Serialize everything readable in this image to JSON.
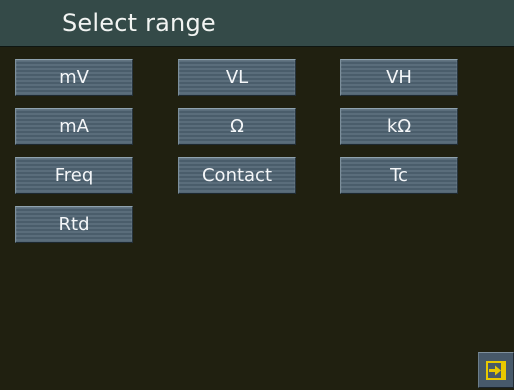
{
  "header": {
    "title": "Select range"
  },
  "ranges": [
    {
      "label": "mV"
    },
    {
      "label": "VL"
    },
    {
      "label": "VH"
    },
    {
      "label": "mA"
    },
    {
      "label": "Ω"
    },
    {
      "label": "kΩ"
    },
    {
      "label": "Freq"
    },
    {
      "label": "Contact"
    },
    {
      "label": "Tc"
    },
    {
      "label": "Rtd"
    }
  ],
  "footer": {
    "exit_icon": "exit-icon"
  },
  "colors": {
    "background": "#202010",
    "title_bar": "#344a48",
    "button": "#52657a",
    "exit_icon_accent": "#e8c800"
  }
}
